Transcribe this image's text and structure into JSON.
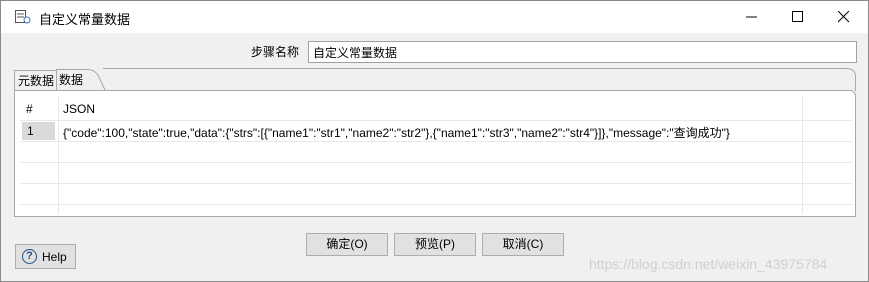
{
  "window": {
    "title": "自定义常量数据"
  },
  "form": {
    "step_name_label": "步骤名称",
    "step_name_value": "自定义常量数据"
  },
  "tabs": [
    {
      "label": "元数据"
    },
    {
      "label": "数据",
      "active": true
    }
  ],
  "table": {
    "columns": [
      "#",
      "JSON"
    ],
    "rows": [
      {
        "num": "1",
        "json": "{\"code\":100,\"state\":true,\"data\":{\"strs\":[{\"name1\":\"str1\",\"name2\":\"str2\"},{\"name1\":\"str3\",\"name2\":\"str4\"}]},\"message\":\"查询成功\"}"
      }
    ]
  },
  "buttons": {
    "ok": "确定(O)",
    "preview": "预览(P)",
    "cancel": "取消(C)",
    "help": "Help"
  },
  "watermark": "https://blog.csdn.net/weixin_43975784",
  "icons": [
    "app-icon",
    "minimize-icon",
    "maximize-icon",
    "close-icon",
    "help-icon"
  ],
  "colors": {
    "dialog_bg": "#f0f0f0",
    "selected_row_num": "#d9d9d9",
    "help_icon": "#1e4f8c"
  }
}
